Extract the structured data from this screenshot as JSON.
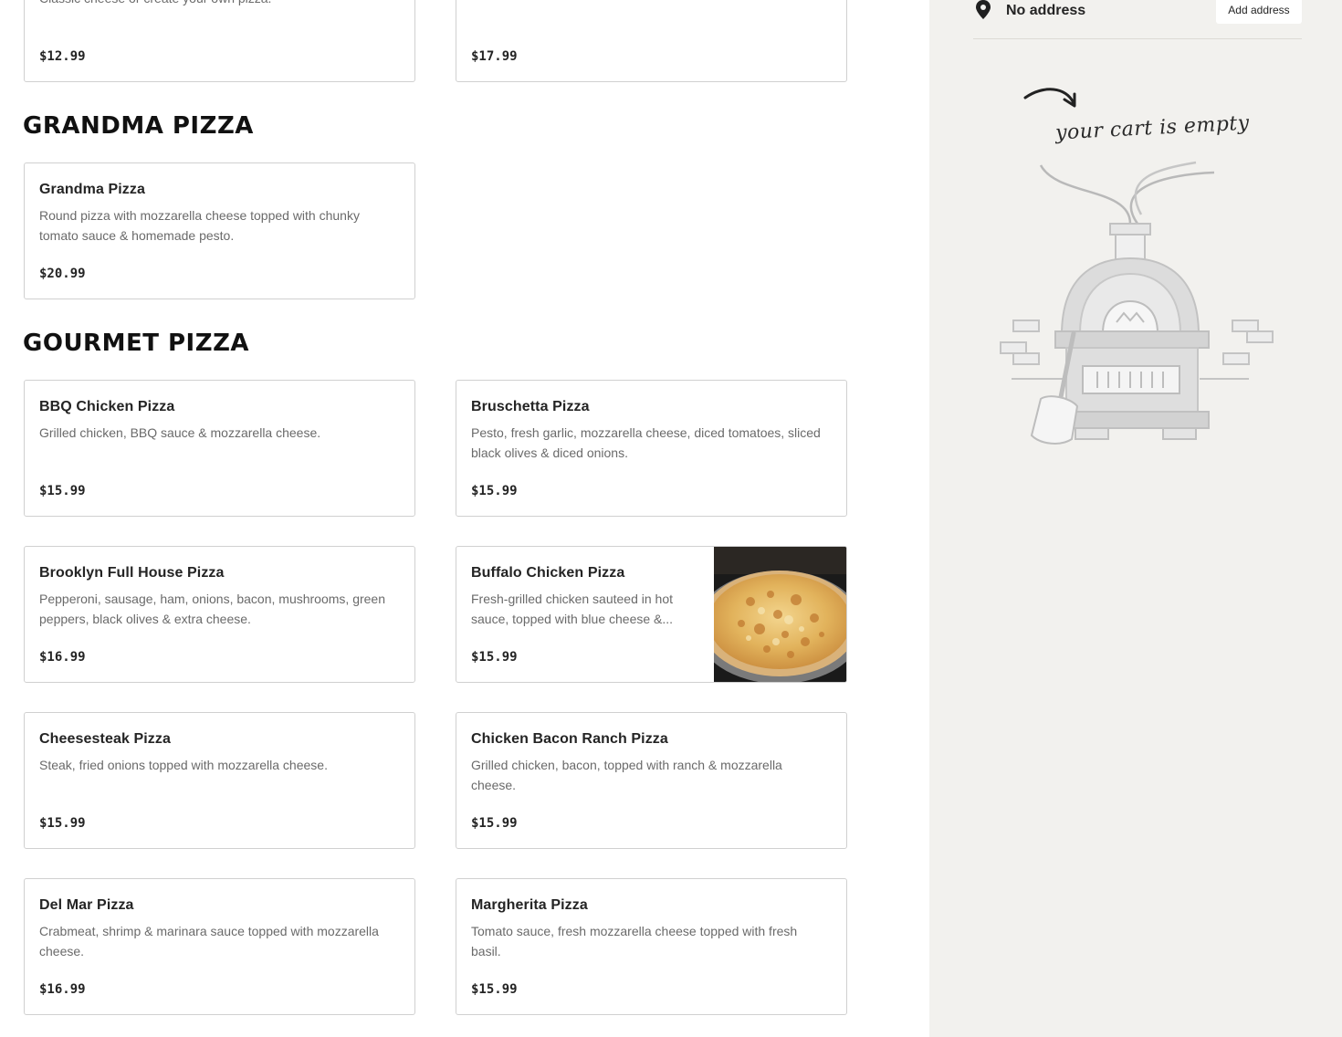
{
  "top_cards": [
    {
      "desc": "Classic cheese or create your own pizza.",
      "price": "$12.99"
    },
    {
      "desc": "",
      "price": "$17.99"
    }
  ],
  "sections": {
    "grandma": {
      "title": "GRANDMA PIZZA",
      "items": [
        {
          "name": "Grandma Pizza",
          "desc": "Round pizza with mozzarella cheese topped with chunky tomato sauce & homemade pesto.",
          "price": "$20.99"
        }
      ]
    },
    "gourmet": {
      "title": "GOURMET PIZZA",
      "items": [
        {
          "name": "BBQ Chicken Pizza",
          "desc": "Grilled chicken, BBQ sauce & mozzarella cheese.",
          "price": "$15.99"
        },
        {
          "name": "Bruschetta Pizza",
          "desc": "Pesto, fresh garlic, mozzarella cheese, diced tomatoes, sliced black olives & diced onions.",
          "price": "$15.99"
        },
        {
          "name": "Brooklyn Full House Pizza",
          "desc": "Pepperoni, sausage, ham, onions, bacon, mushrooms, green peppers, black olives & extra cheese.",
          "price": "$16.99"
        },
        {
          "name": "Buffalo Chicken Pizza",
          "desc": "Fresh-grilled chicken sauteed in hot sauce, topped with blue cheese &...",
          "price": "$15.99"
        },
        {
          "name": "Cheesesteak Pizza",
          "desc": "Steak, fried onions topped with mozzarella cheese.",
          "price": "$15.99"
        },
        {
          "name": "Chicken Bacon Ranch Pizza",
          "desc": "Grilled chicken, bacon, topped with ranch & mozzarella cheese.",
          "price": "$15.99"
        },
        {
          "name": "Del Mar Pizza",
          "desc": "Crabmeat, shrimp & marinara sauce topped with mozzarella cheese.",
          "price": "$16.99"
        },
        {
          "name": "Margherita Pizza",
          "desc": "Tomato sauce, fresh mozzarella cheese topped with fresh basil.",
          "price": "$15.99"
        }
      ]
    }
  },
  "sidebar": {
    "address_text": "No address",
    "add_address_label": "Add address",
    "empty_cart_text": "your cart is empty",
    "pin_icon": "location-pin-icon"
  },
  "colors": {
    "sidebar_bg": "#f2f1ee",
    "card_border": "#d0d0d0",
    "text_muted": "#6a6a6a"
  }
}
